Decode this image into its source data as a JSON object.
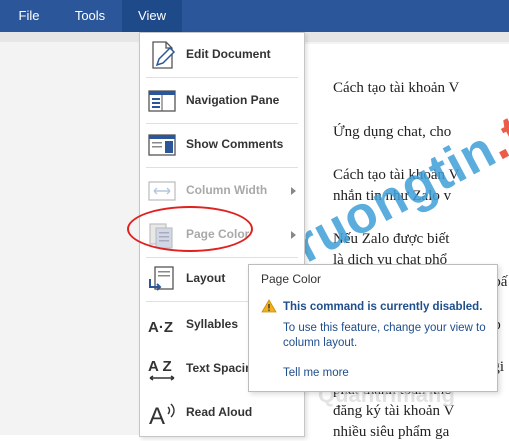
{
  "menubar": {
    "file": "File",
    "tools": "Tools",
    "view": "View"
  },
  "view_menu": {
    "items": [
      {
        "label": "Edit Document",
        "icon": "edit-document-icon",
        "enabled": true,
        "submenu": false
      },
      {
        "label": "Navigation Pane",
        "icon": "navigation-pane-icon",
        "enabled": true,
        "submenu": false
      },
      {
        "label": "Show Comments",
        "icon": "show-comments-icon",
        "enabled": true,
        "submenu": false
      },
      {
        "label": "Column Width",
        "icon": "column-width-icon",
        "enabled": false,
        "submenu": true
      },
      {
        "label": "Page Color",
        "icon": "page-color-icon",
        "enabled": false,
        "submenu": true
      },
      {
        "label": "Layout",
        "icon": "layout-icon",
        "enabled": true,
        "submenu": false
      },
      {
        "label": "Syllables",
        "icon": "syllables-icon",
        "enabled": true,
        "submenu": false
      },
      {
        "label": "Text Spacing",
        "icon": "text-spacing-icon",
        "enabled": true,
        "submenu": false
      },
      {
        "label": "Read Aloud",
        "icon": "read-aloud-icon",
        "enabled": true,
        "submenu": false
      }
    ]
  },
  "tooltip": {
    "title": "Page Color",
    "heading": "This command is currently disabled.",
    "body": "To use this feature, change your view to column layout.",
    "link": "Tell me more"
  },
  "document": {
    "lines": [
      "Cách tạo tài khoản V",
      "Ứng dụng chat, cho",
      "Cách tạo tài khoản V",
      "nhắn tin như Zalo v",
      "Nếu Zalo được biết",
      "là dịch vụ chat phổ",
      "y bấ",
      "o p",
      "ế gi",
      "phát thành toàn khó",
      "đăng ký tài khoản V",
      "nhiều siêu phẩm ga"
    ]
  },
  "watermark": {
    "main": "Truongtin",
    "tail": ".top",
    "bottom": "Quantrimang"
  },
  "colors": {
    "ribbon": "#2b579a",
    "highlight_circle": "#e0221f",
    "tooltip_text": "#1f4e8c",
    "warning": "#f2b01e"
  }
}
